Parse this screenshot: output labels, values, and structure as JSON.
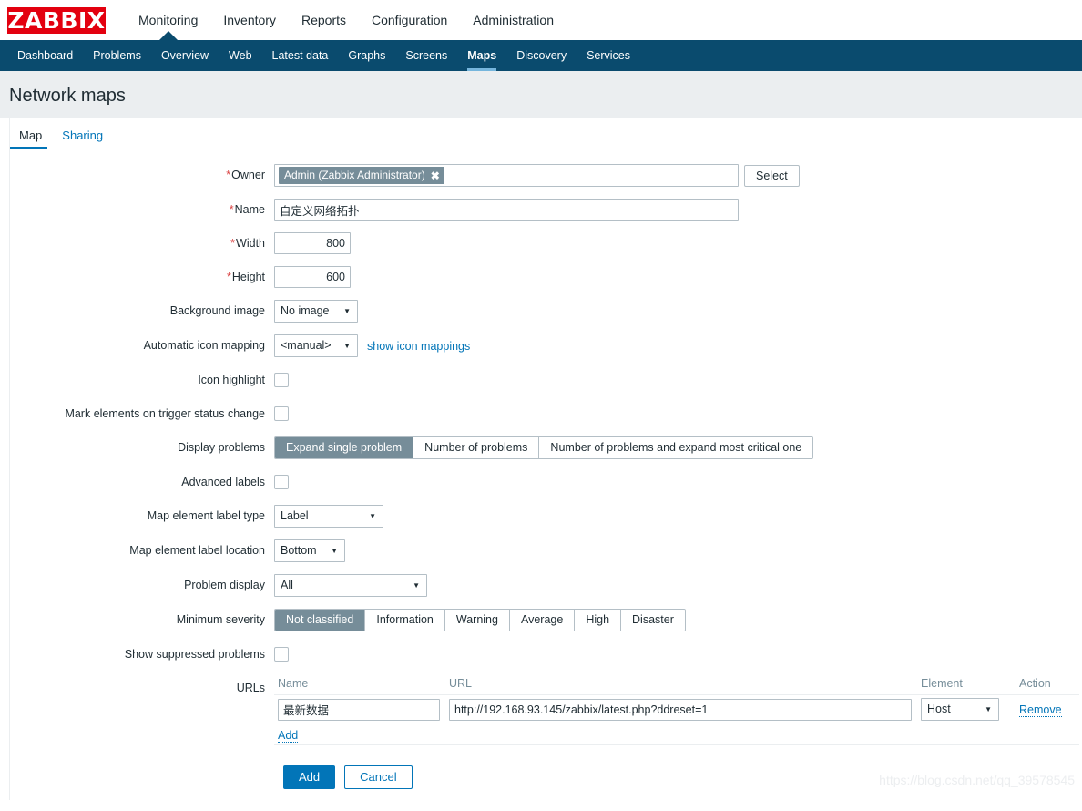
{
  "brand": {
    "logo_text": "ZABBIX",
    "logo_color": "#e3000f"
  },
  "topnav": {
    "items": [
      {
        "label": "Monitoring",
        "active": true
      },
      {
        "label": "Inventory",
        "active": false
      },
      {
        "label": "Reports",
        "active": false
      },
      {
        "label": "Configuration",
        "active": false
      },
      {
        "label": "Administration",
        "active": false
      }
    ]
  },
  "subnav": {
    "bg_color": "#0a4b6e",
    "indicator_color": "#76b6dd",
    "items": [
      {
        "label": "Dashboard",
        "active": false
      },
      {
        "label": "Problems",
        "active": false
      },
      {
        "label": "Overview",
        "active": false
      },
      {
        "label": "Web",
        "active": false
      },
      {
        "label": "Latest data",
        "active": false
      },
      {
        "label": "Graphs",
        "active": false
      },
      {
        "label": "Screens",
        "active": false
      },
      {
        "label": "Maps",
        "active": true
      },
      {
        "label": "Discovery",
        "active": false
      },
      {
        "label": "Services",
        "active": false
      }
    ]
  },
  "page": {
    "title": "Network maps"
  },
  "tabs": [
    {
      "label": "Map",
      "active": true
    },
    {
      "label": "Sharing",
      "active": false
    }
  ],
  "form": {
    "owner": {
      "label": "Owner",
      "required": true,
      "chip_value": "Admin (Zabbix Administrator)",
      "remove_glyph": "✖",
      "select_button": "Select"
    },
    "name": {
      "label": "Name",
      "required": true,
      "value": "自定义网络拓扑"
    },
    "width": {
      "label": "Width",
      "required": true,
      "value": "800"
    },
    "height": {
      "label": "Height",
      "required": true,
      "value": "600"
    },
    "background_image": {
      "label": "Background image",
      "value": "No image"
    },
    "automatic_icon_mapping": {
      "label": "Automatic icon mapping",
      "value": "<manual>",
      "link": "show icon mappings"
    },
    "icon_highlight": {
      "label": "Icon highlight",
      "checked": false
    },
    "mark_elements": {
      "label": "Mark elements on trigger status change",
      "checked": false
    },
    "display_problems": {
      "label": "Display problems",
      "options": [
        "Expand single problem",
        "Number of problems",
        "Number of problems and expand most critical one"
      ],
      "selected": "Expand single problem"
    },
    "advanced_labels": {
      "label": "Advanced labels",
      "checked": false
    },
    "map_element_label_type": {
      "label": "Map element label type",
      "value": "Label"
    },
    "map_element_label_location": {
      "label": "Map element label location",
      "value": "Bottom"
    },
    "problem_display": {
      "label": "Problem display",
      "value": "All"
    },
    "minimum_severity": {
      "label": "Minimum severity",
      "options": [
        "Not classified",
        "Information",
        "Warning",
        "Average",
        "High",
        "Disaster"
      ],
      "selected": "Not classified"
    },
    "show_suppressed": {
      "label": "Show suppressed problems",
      "checked": false
    },
    "urls": {
      "label": "URLs",
      "columns": [
        "Name",
        "URL",
        "Element",
        "Action"
      ],
      "rows": [
        {
          "name": "最新数据",
          "url": "http://192.168.93.145/zabbix/latest.php?ddreset=1",
          "element": "Host",
          "action": "Remove"
        }
      ],
      "add_link": "Add"
    }
  },
  "footer": {
    "submit_label": "Add",
    "cancel_label": "Cancel",
    "primary_color": "#0275b8"
  },
  "watermark": {
    "text": "https://blog.csdn.net/qq_39578545"
  }
}
